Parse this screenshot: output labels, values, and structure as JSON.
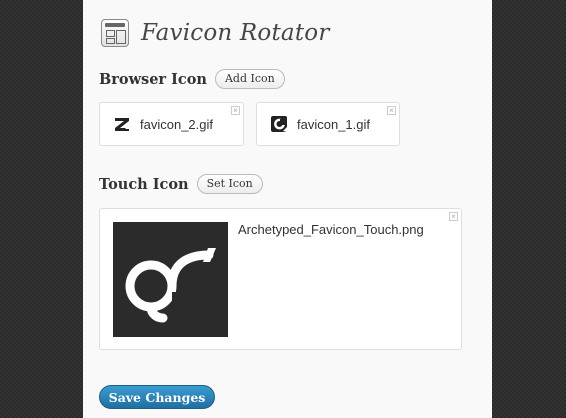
{
  "page": {
    "title": "Favicon Rotator",
    "title_icon": "admin-page-icon"
  },
  "browser_icon": {
    "label": "Browser Icon",
    "button": "Add Icon",
    "items": [
      {
        "filename": "favicon_2.gif",
        "icon": "favicon-z-icon"
      },
      {
        "filename": "favicon_1.gif",
        "icon": "favicon-c-icon"
      }
    ]
  },
  "touch_icon": {
    "label": "Touch Icon",
    "button": "Set Icon",
    "filename": "Archetyped_Favicon_Touch.png",
    "icon": "archetyped-logo"
  },
  "actions": {
    "save": "Save Changes"
  },
  "colors": {
    "background": "#2b2b2b",
    "panel": "#f9f9f9",
    "primary_button": "#2a85bb"
  }
}
